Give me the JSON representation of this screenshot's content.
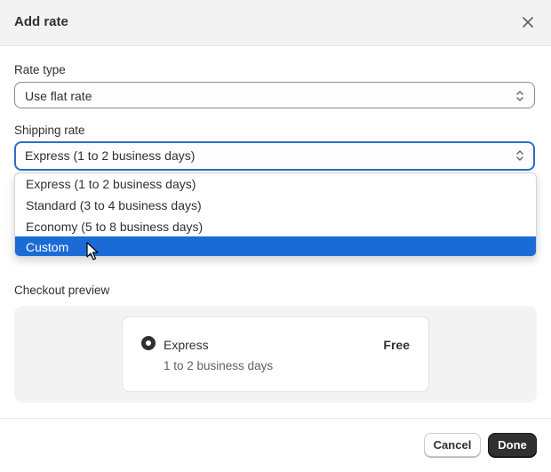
{
  "modal": {
    "title": "Add rate"
  },
  "rate_type": {
    "label": "Rate type",
    "value": "Use flat rate"
  },
  "shipping_rate": {
    "label": "Shipping rate",
    "value": "Express (1 to 2 business days)",
    "options": [
      "Express (1 to 2 business days)",
      "Standard (3 to 4 business days)",
      "Economy (5 to 8 business days)",
      "Custom"
    ],
    "highlighted_option": "Custom"
  },
  "checkout_preview": {
    "label": "Checkout preview",
    "rate_name": "Express",
    "rate_price": "Free",
    "delivery_time": "1 to 2 business days"
  },
  "footer": {
    "cancel_label": "Cancel",
    "done_label": "Done"
  },
  "icons": {
    "close": "close-icon",
    "select_chevron": "select-chevron-icon",
    "cursor": "mouse-pointer-icon"
  },
  "colors": {
    "focus_border": "#2c6ecb",
    "selected_option": "#1b6bd6",
    "primary_button": "#303030",
    "header_bg": "#f3f3f3"
  }
}
